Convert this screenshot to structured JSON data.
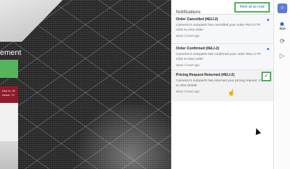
{
  "background": {
    "label": "ement",
    "red_card": {
      "line1": "Due In: 19",
      "line2": "Active: 70"
    }
  },
  "notifications": {
    "title": "Notifications",
    "mark_all_label": "Mark all as read",
    "items": [
      {
        "title": "Order Cancelled (#ELI-2)",
        "body": "Cameron's Autoparts has cancelled your order #ELI-2-TF. Click to view order",
        "time": "about 1 hours ago",
        "unread": true
      },
      {
        "title": "Order Confirmed (#ELI-2)",
        "body": "Cameron's Autoparts has confirmed your order #ELI-2-TF. Click to view order",
        "time": "about 1 hours ago",
        "unread": true
      },
      {
        "title": "Pricing Request Returned (#ELI-2)",
        "body": "Cameron's Autoparts has returned your pricing request. Click to view details",
        "time": "about 4 hours ago",
        "unread": false
      }
    ]
  },
  "toolbar": {
    "icons": [
      "avatar-icon",
      "bell-icon",
      "refresh-icon",
      "play-icon"
    ]
  },
  "colors": {
    "accent_green": "#4caf50",
    "link_blue": "#2f6fd0",
    "brand_blue": "#5b7bd5",
    "card_red": "#8e1b2a",
    "card_green": "#58b35d"
  }
}
